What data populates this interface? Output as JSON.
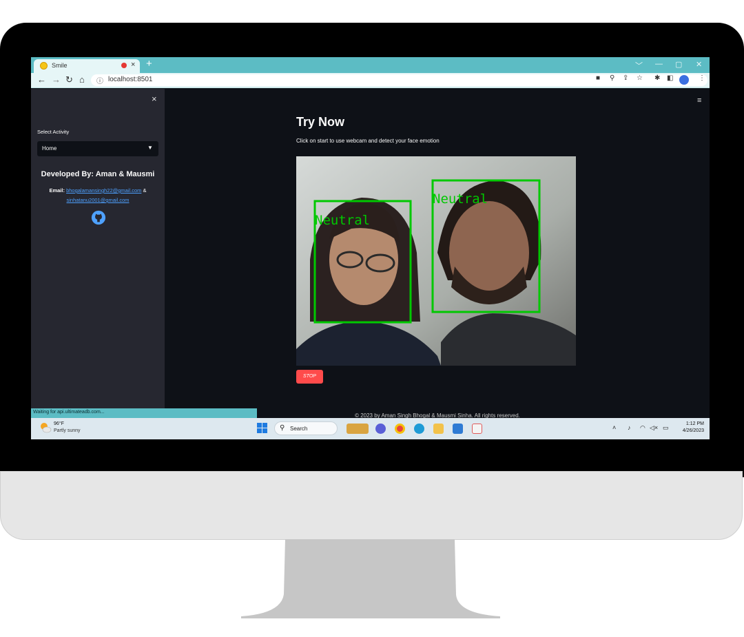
{
  "browser": {
    "tab_title": "Smile",
    "tab_close": "×",
    "new_tab": "+",
    "url": "localhost:8501",
    "window_controls": [
      "﹀",
      "—",
      "▢",
      "✕"
    ],
    "nav": {
      "back": "←",
      "forward": "→",
      "reload": "↻",
      "home": "⌂"
    },
    "status_text": "Waiting for api.ultimateadb.com..."
  },
  "sidebar": {
    "close": "×",
    "select_label": "Select Activity",
    "select_value": "Home",
    "developed_by": "Developed By: Aman & Mausmi",
    "email_label": "Email:",
    "email_1": "bhogalamansingh22@gmail.com",
    "email_sep": "&",
    "email_2": "sinhatanu2001@gmail.com"
  },
  "main": {
    "title": "Try Now",
    "subtitle": "Click on start to use webcam and detect your face emotion",
    "stop_label": "STOP",
    "footer": "© 2023 by Aman Singh Bhogal & Mausmi Sinha. All rights reserved.",
    "detections": [
      "Neutral",
      "Neutral"
    ]
  },
  "taskbar": {
    "weather_temp": "96°F",
    "weather_desc": "Partly sunny",
    "search_label": "Search",
    "time": "1:12 PM",
    "date": "4/26/2023"
  },
  "colors": {
    "accent": "#ff4b4b",
    "box": "#00c800",
    "sidebar_bg": "#262730",
    "app_bg": "#0e1117",
    "browser_chrome": "#5cbcc4"
  }
}
